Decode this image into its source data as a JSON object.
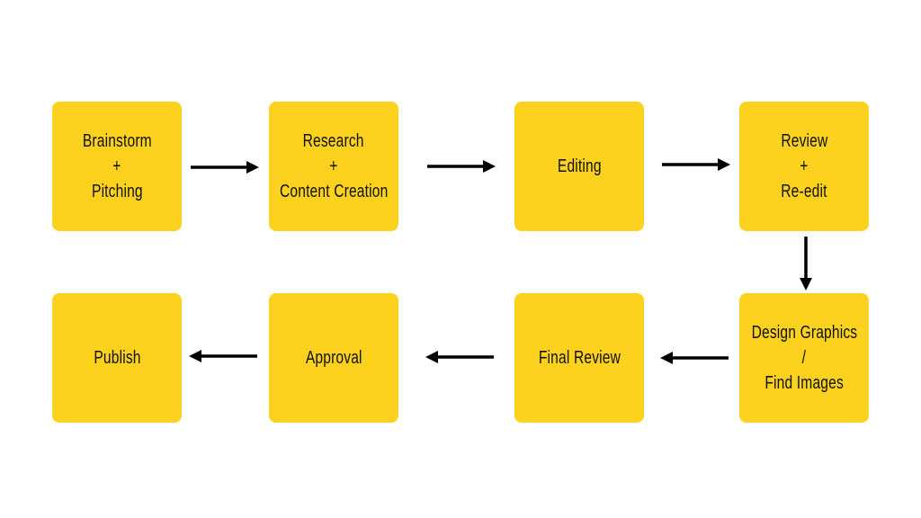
{
  "box_color": "#FCD21E",
  "steps": [
    {
      "lines": [
        "Brainstorm",
        "+",
        "Pitching"
      ]
    },
    {
      "lines": [
        "Research",
        "+",
        "Content Creation"
      ]
    },
    {
      "lines": [
        "Editing"
      ]
    },
    {
      "lines": [
        "Review",
        "+",
        "Re-edit"
      ]
    },
    {
      "lines": [
        "Design Graphics",
        "/",
        "Find Images"
      ]
    },
    {
      "lines": [
        "Final Review"
      ]
    },
    {
      "lines": [
        "Approval"
      ]
    },
    {
      "lines": [
        "Publish"
      ]
    }
  ]
}
